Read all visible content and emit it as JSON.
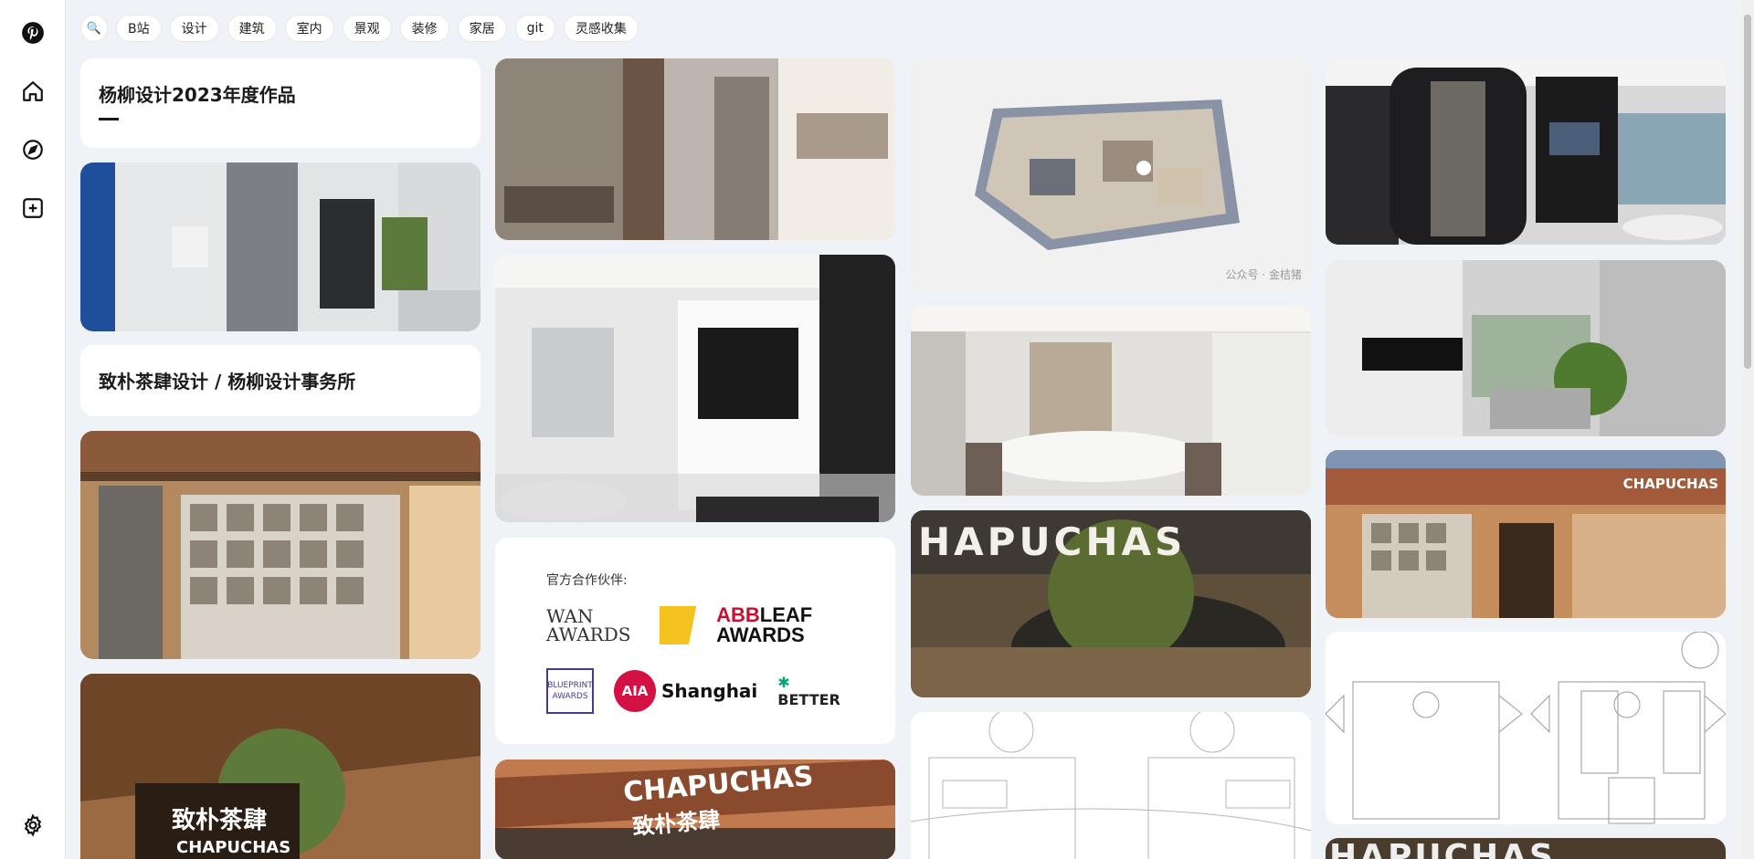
{
  "chips": [
    "B站",
    "设计",
    "建筑",
    "室内",
    "景观",
    "装修",
    "家居",
    "git",
    "灵感收集"
  ],
  "cards": {
    "title_card": "杨柳设计2023年度作品",
    "subtitle_card": "致朴茶肆设计 / 杨柳设计事务所",
    "watermark": "公众号 · 金桔猪"
  },
  "partners": {
    "label": "官方合作伙伴:",
    "wan": "WAN AWARDS",
    "abb_red": "ABB",
    "abb_rest": "LEAF AWARDS",
    "blueprint": "BLUEPRINT AWARDS",
    "aia_circle": "AIA",
    "aia_text": "Shanghai",
    "better": "BETTER"
  },
  "signage": {
    "chapuchas": "CHAPUCHAS",
    "zhipu": "致朴茶肆",
    "hapuchas": "HAPUCHAS"
  },
  "icons": {
    "pinterest": "pinterest-logo-icon",
    "home": "home-icon",
    "explore": "compass-icon",
    "create": "plus-square-icon",
    "settings": "gear-icon",
    "search": "search-icon"
  }
}
